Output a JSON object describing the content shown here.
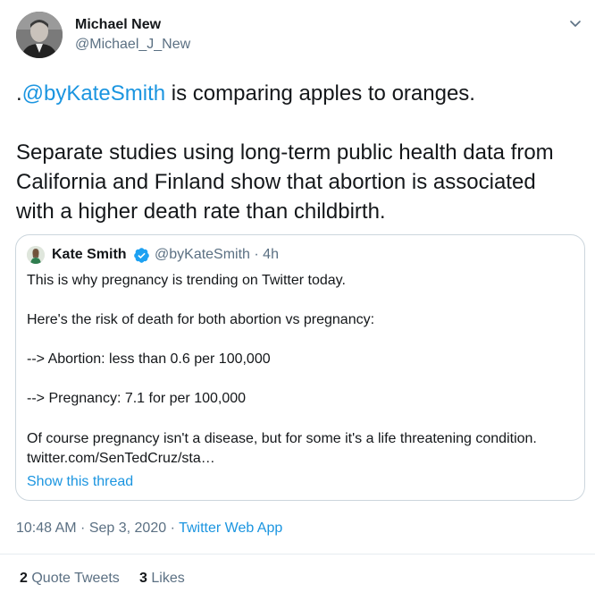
{
  "author": {
    "name": "Michael New",
    "handle": "@Michael_J_New"
  },
  "tweet": {
    "prefix": ".",
    "mention": "@byKateSmith",
    "line1_rest": " is comparing apples to oranges.",
    "paragraph2": "Separate studies using long-term public health data from California and Finland show that abortion is associated with a higher death rate than childbirth."
  },
  "quote": {
    "name": "Kate Smith",
    "handle": "@byKateSmith",
    "separator": " · ",
    "time": "4h",
    "lines": [
      "This is why pregnancy is trending on Twitter today.",
      "Here's the risk of death for both abortion vs pregnancy:",
      "--> Abortion: less than 0.6 per 100,000",
      "--> Pregnancy: 7.1 for per 100,000",
      "Of course pregnancy isn't a disease, but for some it's a life threatening condition.",
      "twitter.com/SenTedCruz/sta…"
    ],
    "show_thread": "Show this thread"
  },
  "timestamp": {
    "time": "10:48 AM",
    "separator": " · ",
    "date": "Sep 3, 2020",
    "app": "Twitter Web App"
  },
  "stats": {
    "quote_tweets_count": "2",
    "quote_tweets_label": "Quote Tweets",
    "likes_count": "3",
    "likes_label": "Likes"
  },
  "colors": {
    "link": "#1b95e0",
    "muted": "#5b7083",
    "verified": "#1da1f2"
  },
  "icons": {
    "menu": "chevron-down-icon",
    "verified": "verified-badge-icon"
  }
}
